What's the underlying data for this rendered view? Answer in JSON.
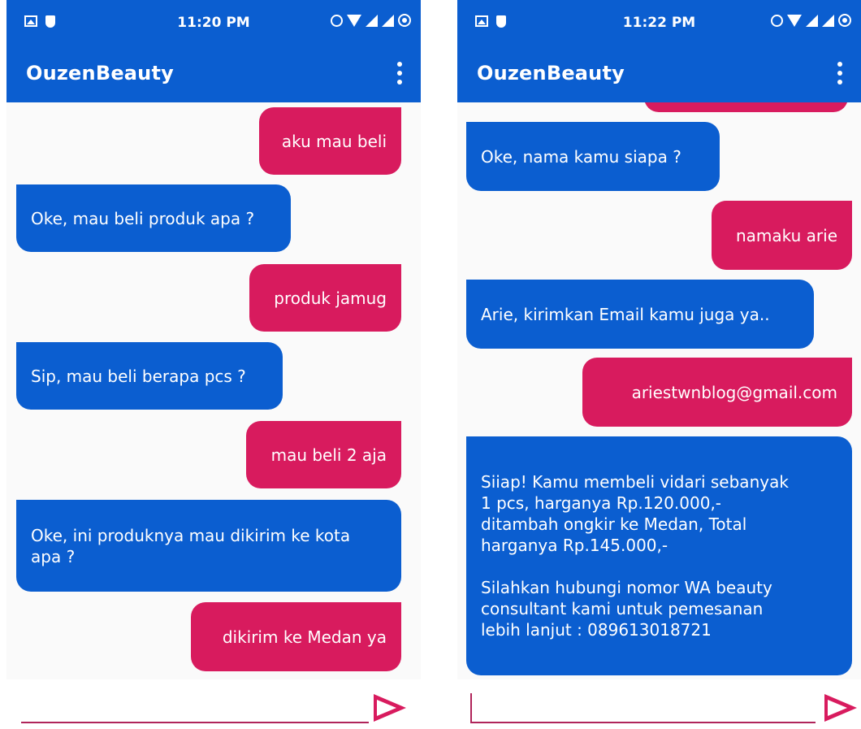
{
  "colors": {
    "primary": "#0b5ed0",
    "accent": "#d81b5e",
    "background": "#fafafa",
    "text_on_color": "#ffffff"
  },
  "left": {
    "status": {
      "time": "11:20 PM"
    },
    "app_title": "OuzenBeauty",
    "messages": [
      {
        "sender": "user",
        "text": "aku mau beli"
      },
      {
        "sender": "bot",
        "text": "Oke, mau beli produk apa ?"
      },
      {
        "sender": "user",
        "text": "produk jamug"
      },
      {
        "sender": "bot",
        "text": "Sip, mau beli berapa pcs ?"
      },
      {
        "sender": "user",
        "text": "mau beli 2 aja"
      },
      {
        "sender": "bot",
        "text": "Oke, ini produknya mau dikirim ke kota\napa ?"
      },
      {
        "sender": "user",
        "text": "dikirim ke Medan ya"
      }
    ],
    "input": {
      "value": ""
    },
    "icons": [
      "image-icon",
      "shield-icon",
      "alarm-icon",
      "wifi-icon",
      "signal-icon",
      "battery-icon",
      "overflow-menu-icon",
      "send-icon"
    ]
  },
  "right": {
    "status": {
      "time": "11:22 PM"
    },
    "app_title": "OuzenBeauty",
    "messages": [
      {
        "sender": "user",
        "text": ""
      },
      {
        "sender": "bot",
        "text": "Oke, nama kamu siapa ?"
      },
      {
        "sender": "user",
        "text": "namaku arie"
      },
      {
        "sender": "bot",
        "text": "Arie, kirimkan Email kamu juga ya.."
      },
      {
        "sender": "user",
        "text": "ariestwnblog@gmail.com"
      },
      {
        "sender": "bot",
        "text": "Siiap! Kamu membeli vidari sebanyak\n1 pcs, harganya Rp.120.000,-\nditambah ongkir ke Medan, Total\nharganya Rp.145.000,-\n\nSilahkan hubungi nomor WA beauty\nconsultant kami untuk pemesanan\nlebih lanjut : 089613018721"
      }
    ],
    "input": {
      "value": ""
    },
    "icons": [
      "image-icon",
      "shield-icon",
      "alarm-icon",
      "wifi-icon",
      "signal-icon",
      "battery-icon",
      "overflow-menu-icon",
      "send-icon"
    ]
  }
}
